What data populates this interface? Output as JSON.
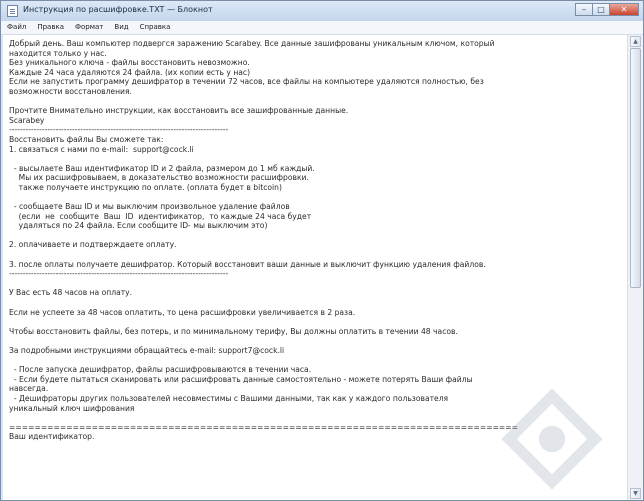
{
  "window": {
    "title": "Инструкция по расшифровке.TXT — Блокнот",
    "controls": {
      "minimize": "–",
      "maximize": "□",
      "close": "✕"
    }
  },
  "menubar": {
    "items": [
      "Файл",
      "Правка",
      "Формат",
      "Вид",
      "Справка"
    ]
  },
  "document": {
    "text": "Добрый день. Ваш компьютер подвергся заражению Scarabey. Все данные зашифрованы уникальным ключом, который\nнаходится только у нас.\nБез уникального ключа - файлы восстановить невозможно.\nКаждые 24 часа удаляются 24 файла. (их копии есть у нас)\nЕсли не запустить программу дешифратор в течении 72 часов, все файлы на компьютере удаляются полностью, без\nвозможности восстановления.\n\nПрочтите Внимательно инструкции, как восстановить все зашифрованные данные.\nScarabey\n--------------------------------------------------------------------------------\nВосстановить файлы Вы сможете так:\n1. связаться с нами по e-mail:  support@cock.li\n\n  - высылаете Ваш идентификатор ID и 2 файла, размером до 1 мб каждый.\n    Мы их расшифровываем, в доказательство возможности расшифровки.\n    также получаете инструкцию по оплате. (оплата будет в bitcoin)\n\n  - сообщаете Ваш ID и мы выключим произвольное удаление файлов\n    (если  не  сообщите  Ваш  ID  идентификатор,  то каждые 24 часа будет\n    удаляться по 24 файла. Если сообщите ID- мы выключим это)\n\n2. оплачиваете и подтверждаете оплату.\n\n3. после оплаты получаете дешифратор. Который восстановит ваши данные и выключит функцию удаления файлов.\n--------------------------------------------------------------------------------\n\nУ Вас есть 48 часов на оплату.\n\nЕсли не успеете за 48 часов оплатить, то цена расшифровки увеличивается в 2 раза.\n\nЧтобы восстановить файлы, без потерь, и по минимальному терифу, Вы должны оплатить в течении 48 часов.\n\nЗа подробными инструкциями обращайтесь e-mail: support7@cock.li\n\n  - После запуска дешифратор, файлы расшифровываются в течении часа.\n  - Если будете пытаться сканировать или расшифровать данные самостоятельно - можете потерять Ваши файлы\nнавсегда.\n  - Дешифраторы других пользователей несовместимы с Вашими данными, так как у каждого пользователя\nуникальный ключ шифрования\n\n================================================================================\nВаш идентификатор."
  }
}
